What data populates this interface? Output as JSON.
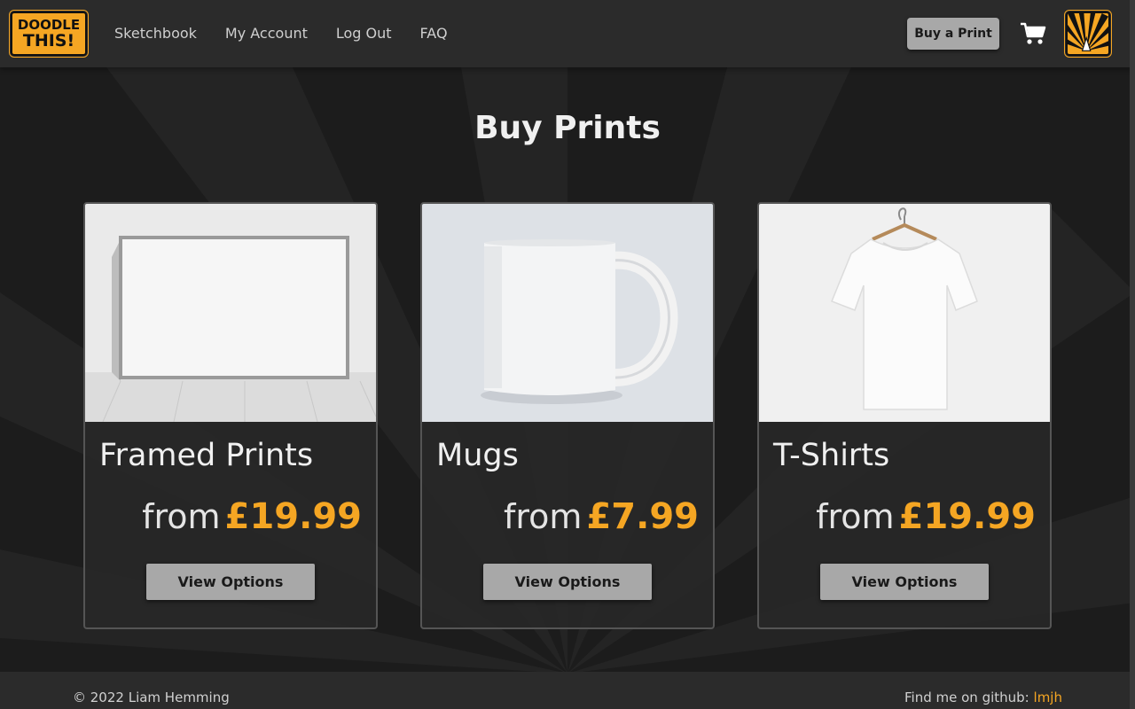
{
  "header": {
    "logo": {
      "line1": "DOODLE",
      "line2": "THIS!"
    },
    "nav": [
      {
        "label": "Sketchbook"
      },
      {
        "label": "My Account"
      },
      {
        "label": "Log Out"
      },
      {
        "label": "FAQ"
      }
    ],
    "buy_button_label": "Buy a Print",
    "cart_icon": "shopping-cart-icon",
    "avatar_icon": "pencil-sunburst-icon"
  },
  "main": {
    "title": "Buy Prints",
    "cards": [
      {
        "title": "Framed Prints",
        "from_label": "from",
        "price": "£19.99",
        "button_label": "View Options",
        "image": "framed-print-image"
      },
      {
        "title": "Mugs",
        "from_label": "from",
        "price": "£7.99",
        "button_label": "View Options",
        "image": "mug-image"
      },
      {
        "title": "T-Shirts",
        "from_label": "from",
        "price": "£19.99",
        "button_label": "View Options",
        "image": "tshirt-image"
      }
    ]
  },
  "footer": {
    "copyright": "© 2022 Liam Hemming",
    "github_prefix": "Find me on github:",
    "github_link": "lmjh"
  },
  "colors": {
    "accent": "#f5a623",
    "background": "#1c1c1c",
    "header": "#2b2b2b",
    "button": "#a8a8a8"
  }
}
